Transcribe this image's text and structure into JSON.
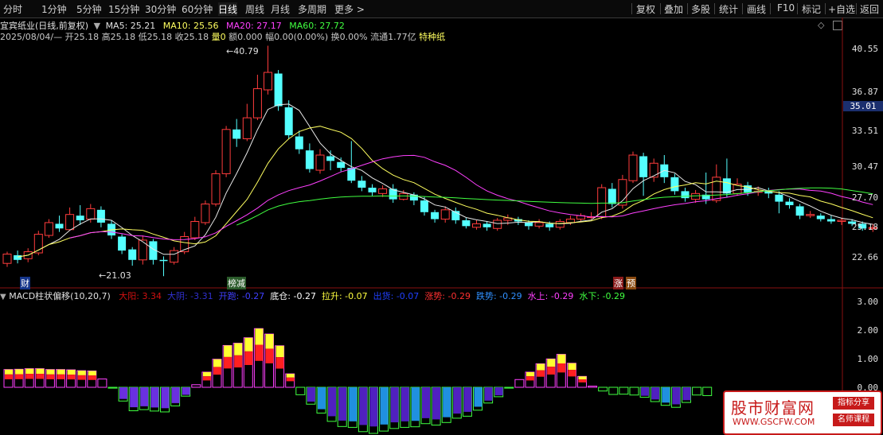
{
  "toolbar": {
    "left": [
      "分时",
      "1分钟",
      "5分钟",
      "15分钟",
      "30分钟",
      "60分钟",
      "日线",
      "周线",
      "月线",
      "多周期",
      "更多 >"
    ],
    "active": "日线",
    "right": [
      "复权",
      "叠加",
      "多股",
      "统计",
      "画线",
      "F10",
      "标记",
      "+自选",
      "返回"
    ]
  },
  "stock": {
    "title": "宜宾纸业(日线,前复权)",
    "ma5": "MA5: 25.21",
    "ma10": "MA10: 25.56",
    "ma20": "MA20: 27.17",
    "ma60": "MA60: 27.72",
    "info_date": "2025/08/04/—",
    "info_open": "开25.18",
    "info_high": "高25.18",
    "info_low": "低25.18",
    "info_close": "收25.18",
    "info_vol": "量0",
    "info_amt": "额0.000",
    "info_amp": "幅0.00(0.00%)",
    "info_turn": "换0.00%",
    "info_float": "流通1.77亿",
    "info_sector": "特种纸"
  },
  "price_axis": [
    "40.55",
    "36.87",
    "35.01",
    "33.51",
    "30.47",
    "27.70",
    "25.18",
    "22.66"
  ],
  "price_current_label": "35.01",
  "annotations": {
    "high": "40.79",
    "low": "21.03",
    "mark1": "财",
    "mark2": "榜减",
    "mark3": "涨",
    "mark4": "预"
  },
  "macd": {
    "title": "MACD柱状偏移(10,20,7)",
    "items": [
      {
        "label": "大阳: 3.34",
        "color": "#d01010"
      },
      {
        "label": "大阴: -3.31",
        "color": "#3030d0"
      },
      {
        "label": "开跑: -0.27",
        "color": "#4040ff"
      },
      {
        "label": "底仓: -0.27",
        "color": "#ffffff"
      },
      {
        "label": "拉升: -0.07",
        "color": "#ffff40"
      },
      {
        "label": "出货: -0.07",
        "color": "#2040ff"
      },
      {
        "label": "涨势: -0.29",
        "color": "#ff3030"
      },
      {
        "label": "跌势: -0.29",
        "color": "#3090ff"
      },
      {
        "label": "水上: -0.29",
        "color": "#ff40ff"
      },
      {
        "label": "水下: -0.29",
        "color": "#40ff40"
      }
    ],
    "axis": [
      "3.00",
      "2.00",
      "1.00",
      "0.00"
    ]
  },
  "ad": {
    "title": "股市财富网",
    "url": "WWW.GSCFW.COM",
    "tag1": "指标分享",
    "tag2": "名师课程"
  },
  "chart_data": {
    "type": "candlestick",
    "candles": [
      [
        22.1,
        22.9,
        23.1,
        21.8
      ],
      [
        22.8,
        22.4,
        23.2,
        22.1
      ],
      [
        22.5,
        23.1,
        23.4,
        22.2
      ],
      [
        23.0,
        24.6,
        24.9,
        22.8
      ],
      [
        24.5,
        25.6,
        25.9,
        24.3
      ],
      [
        25.5,
        25.1,
        26.2,
        24.8
      ],
      [
        25.0,
        26.3,
        26.9,
        24.9
      ],
      [
        26.2,
        25.8,
        27.1,
        25.4
      ],
      [
        25.9,
        26.8,
        27.2,
        25.6
      ],
      [
        26.7,
        25.6,
        27.0,
        25.2
      ],
      [
        25.5,
        24.5,
        25.8,
        24.2
      ],
      [
        24.4,
        23.2,
        24.6,
        22.9
      ],
      [
        23.3,
        22.4,
        23.5,
        21.9
      ],
      [
        22.4,
        24.1,
        24.5,
        22.0
      ],
      [
        24.0,
        22.4,
        24.2,
        22.0
      ],
      [
        22.4,
        22.3,
        22.7,
        21.0
      ],
      [
        22.2,
        23.2,
        23.5,
        22.0
      ],
      [
        23.1,
        24.4,
        24.8,
        22.9
      ],
      [
        24.3,
        25.7,
        26.1,
        24.1
      ],
      [
        25.6,
        27.2,
        27.5,
        25.4
      ],
      [
        27.2,
        29.8,
        30.1,
        27.0
      ],
      [
        29.8,
        33.6,
        33.9,
        29.5
      ],
      [
        33.6,
        32.8,
        34.5,
        32.1
      ],
      [
        32.8,
        34.6,
        35.8,
        32.6
      ],
      [
        34.6,
        37.1,
        38.3,
        34.4
      ],
      [
        37.0,
        38.5,
        40.79,
        36.6
      ],
      [
        38.4,
        35.6,
        38.7,
        35.2
      ],
      [
        35.5,
        33.1,
        36.1,
        32.8
      ],
      [
        33.0,
        31.9,
        33.5,
        31.5
      ],
      [
        31.8,
        30.2,
        32.4,
        29.9
      ],
      [
        30.1,
        31.4,
        31.9,
        29.8
      ],
      [
        31.3,
        30.9,
        31.8,
        30.1
      ],
      [
        30.8,
        30.3,
        31.2,
        30.0
      ],
      [
        30.3,
        29.2,
        32.6,
        29.0
      ],
      [
        29.2,
        28.6,
        29.6,
        28.3
      ],
      [
        28.6,
        28.2,
        28.9,
        27.9
      ],
      [
        28.1,
        28.5,
        28.8,
        27.8
      ],
      [
        28.5,
        27.6,
        28.9,
        27.3
      ],
      [
        27.6,
        28.1,
        28.4,
        27.5
      ],
      [
        28.0,
        27.5,
        28.2,
        27.1
      ],
      [
        27.5,
        26.5,
        27.8,
        26.2
      ],
      [
        26.5,
        25.9,
        26.7,
        25.6
      ],
      [
        25.9,
        26.7,
        27.0,
        25.6
      ],
      [
        26.6,
        25.8,
        26.9,
        25.5
      ],
      [
        25.8,
        25.3,
        26.0,
        25.1
      ],
      [
        25.2,
        25.5,
        25.8,
        25.0
      ],
      [
        25.5,
        25.2,
        25.7,
        24.9
      ],
      [
        25.1,
        25.8,
        26.0,
        24.9
      ],
      [
        25.8,
        26.0,
        26.3,
        25.4
      ],
      [
        25.9,
        25.7,
        26.1,
        25.4
      ],
      [
        25.6,
        25.3,
        25.8,
        25.0
      ],
      [
        25.3,
        25.6,
        25.9,
        25.1
      ],
      [
        25.5,
        25.2,
        25.7,
        24.9
      ],
      [
        25.2,
        25.7,
        25.9,
        25.0
      ],
      [
        25.6,
        25.9,
        26.2,
        25.4
      ],
      [
        25.9,
        26.2,
        26.4,
        25.7
      ],
      [
        26.1,
        26.1,
        26.5,
        25.9
      ],
      [
        26.1,
        28.6,
        28.9,
        25.9
      ],
      [
        28.5,
        27.2,
        29.0,
        26.9
      ],
      [
        27.1,
        29.3,
        29.7,
        26.8
      ],
      [
        29.2,
        31.4,
        31.7,
        29.0
      ],
      [
        31.3,
        29.5,
        31.6,
        27.9
      ],
      [
        29.5,
        30.7,
        31.1,
        29.1
      ],
      [
        30.6,
        29.5,
        31.4,
        29.0
      ],
      [
        29.5,
        28.3,
        29.8,
        28.0
      ],
      [
        28.3,
        27.7,
        28.6,
        27.4
      ],
      [
        27.6,
        28.1,
        28.4,
        27.3
      ],
      [
        28.0,
        27.6,
        29.9,
        27.2
      ],
      [
        27.5,
        29.5,
        30.6,
        27.3
      ],
      [
        29.4,
        28.1,
        31.1,
        27.8
      ],
      [
        28.1,
        28.9,
        29.4,
        27.9
      ],
      [
        28.8,
        28.2,
        29.1,
        27.9
      ],
      [
        28.2,
        28.3,
        28.7,
        27.9
      ],
      [
        28.3,
        28.1,
        28.6,
        27.7
      ],
      [
        28.0,
        27.4,
        28.3,
        26.4
      ],
      [
        27.4,
        27.1,
        27.7,
        26.8
      ],
      [
        27.0,
        26.2,
        27.2,
        25.9
      ],
      [
        26.2,
        26.3,
        26.6,
        26.0
      ],
      [
        26.2,
        25.9,
        26.4,
        25.7
      ],
      [
        25.9,
        25.7,
        26.2,
        25.5
      ],
      [
        25.7,
        25.8,
        26.0,
        25.4
      ],
      [
        25.7,
        25.5,
        25.9,
        25.3
      ],
      [
        25.5,
        25.1,
        25.7,
        24.9
      ],
      [
        25.1,
        25.18,
        25.5,
        24.8
      ]
    ],
    "macd_values": [
      0.62,
      0.63,
      0.65,
      0.65,
      0.62,
      0.62,
      0.61,
      0.58,
      0.57,
      0.29,
      -0.03,
      -0.48,
      -0.82,
      -0.78,
      -0.83,
      -0.86,
      -0.65,
      -0.31,
      0.09,
      0.53,
      0.98,
      1.46,
      1.54,
      1.73,
      2.05,
      1.86,
      1.45,
      0.47,
      -0.26,
      -0.59,
      -0.9,
      -1.19,
      -1.37,
      -1.4,
      -1.55,
      -1.61,
      -1.53,
      -1.44,
      -1.4,
      -1.38,
      -1.27,
      -1.32,
      -1.23,
      -1.08,
      -1.01,
      -0.8,
      -0.55,
      -0.33,
      -0.03,
      0.27,
      0.53,
      0.82,
      0.99,
      1.15,
      0.84,
      0.38,
      0.04,
      -0.13,
      -0.25,
      -0.24,
      -0.27,
      -0.35,
      -0.5,
      -0.63,
      -0.7,
      -0.53,
      -0.27,
      -0.29
    ],
    "ylim": [
      21,
      41
    ]
  }
}
